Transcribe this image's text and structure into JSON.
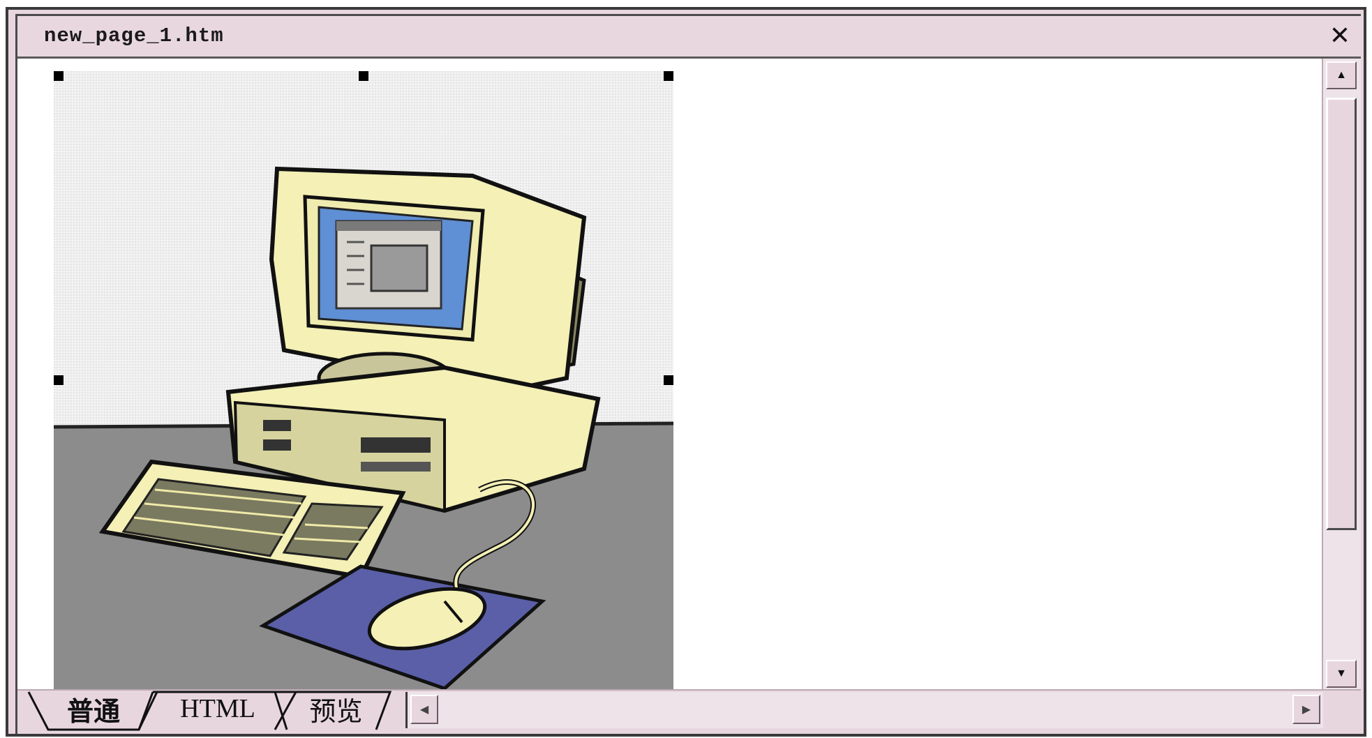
{
  "window": {
    "title": "new_page_1.htm",
    "close_glyph": "✕"
  },
  "content": {
    "image": {
      "subject_icon": "computer-clipart",
      "selected": true
    }
  },
  "view_tabs": [
    {
      "label": "普通",
      "active": true
    },
    {
      "label": "HTML",
      "active": false
    },
    {
      "label": "预览",
      "active": false
    }
  ],
  "scrollbars": {
    "up_glyph": "▲",
    "down_glyph": "▼",
    "left_glyph": "◀",
    "right_glyph": "▶"
  },
  "colors": {
    "chrome": "#e8d6df",
    "screen_blue": "#5f8fd4",
    "case_cream": "#f4f0b6",
    "desk_gray": "#8c8c8c",
    "mousepad_blue": "#5a5fa8"
  }
}
